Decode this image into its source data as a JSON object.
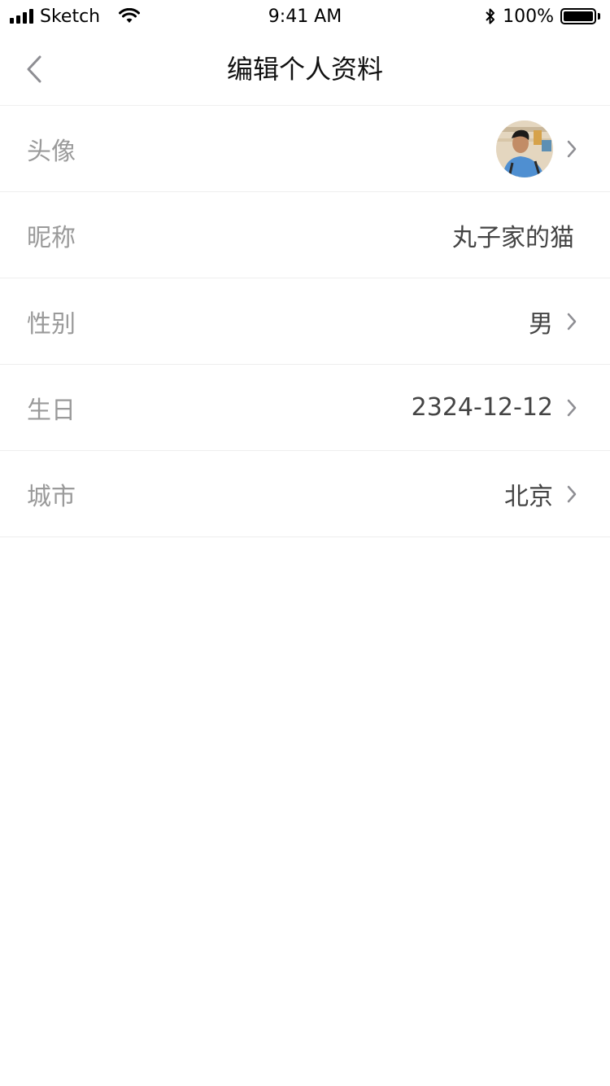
{
  "status_bar": {
    "carrier": "Sketch",
    "time": "9:41 AM",
    "battery": "100%"
  },
  "nav": {
    "title": "编辑个人资料"
  },
  "rows": [
    {
      "label": "头像",
      "value": "",
      "type": "avatar",
      "chevron": true
    },
    {
      "label": "昵称",
      "value": "丸子家的猫",
      "type": "text",
      "chevron": false
    },
    {
      "label": "性别",
      "value": "男",
      "type": "text",
      "chevron": true
    },
    {
      "label": "生日",
      "value": "2324-12-12",
      "type": "text",
      "chevron": true
    },
    {
      "label": "城市",
      "value": "北京",
      "type": "text",
      "chevron": true
    }
  ],
  "colors": {
    "label": "#9a9a9a",
    "value": "#444444",
    "divider": "#eeeeee",
    "chevron": "#8e8e93"
  },
  "icons": {
    "back": "chevron-left-icon",
    "row_arrow": "chevron-right-icon",
    "wifi": "wifi-icon",
    "bluetooth": "bluetooth-icon",
    "signal": "signal-icon",
    "battery": "battery-icon"
  }
}
